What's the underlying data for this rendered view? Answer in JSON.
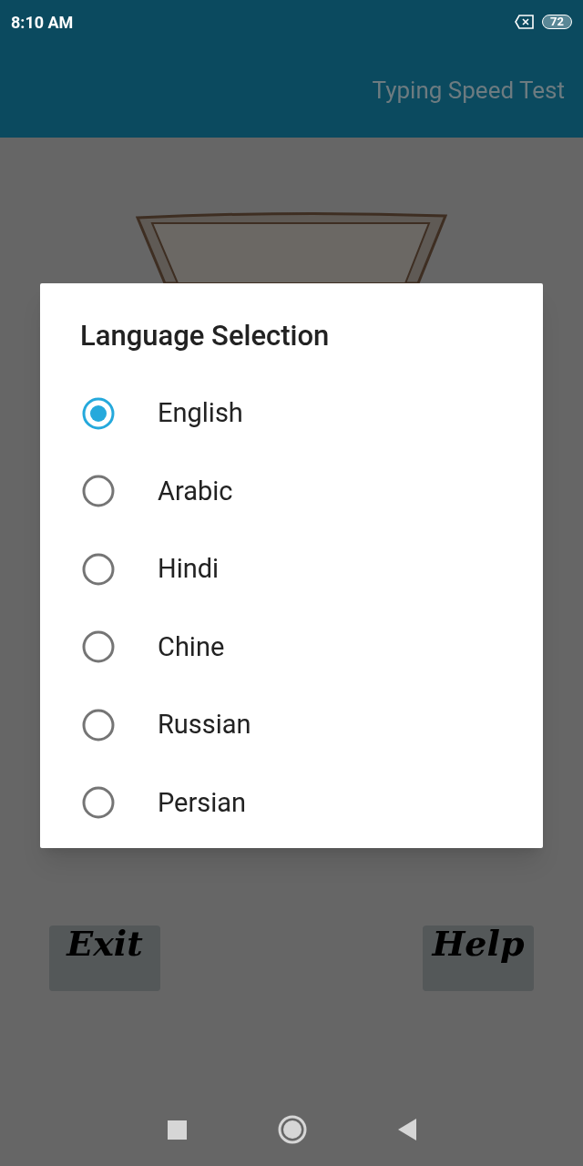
{
  "status_bar": {
    "time": "8:10 AM",
    "battery": "72"
  },
  "app_bar": {
    "title": "Typing Speed Test"
  },
  "buttons": [
    "Exit",
    "Help"
  ],
  "dialog": {
    "title": "Language Selection",
    "options": [
      {
        "label": "English",
        "selected": true
      },
      {
        "label": "Arabic",
        "selected": false
      },
      {
        "label": "Hindi",
        "selected": false
      },
      {
        "label": "Chine",
        "selected": false
      },
      {
        "label": "Russian",
        "selected": false
      },
      {
        "label": "Persian",
        "selected": false
      }
    ]
  }
}
